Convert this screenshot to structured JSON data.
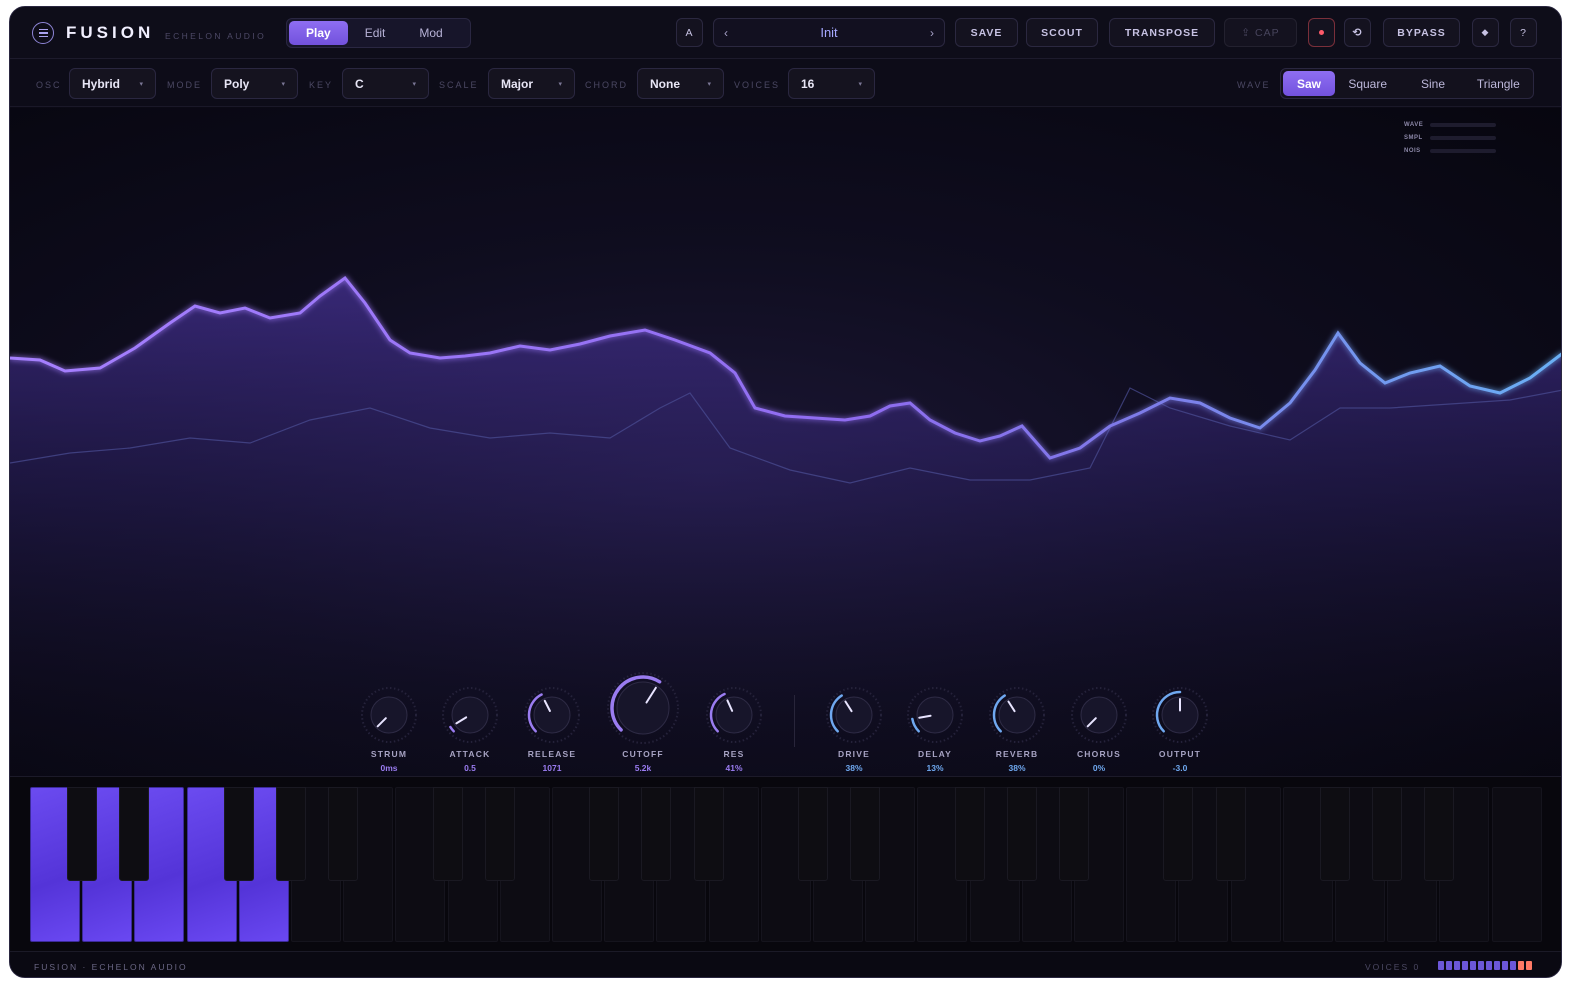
{
  "app": {
    "logo": "FUSION",
    "brand": "ECHELON AUDIO",
    "mode_tabs": [
      "Play",
      "Edit",
      "Mod"
    ],
    "active_mode": "Play"
  },
  "toolbar": {
    "ab_label": "A",
    "prev_arrow": "‹",
    "next_arrow": "›",
    "preset_name": "Init",
    "save_label": "SAVE",
    "scout_label": "SCOUT",
    "transpose_label": "TRANSPOSE",
    "cap_label": "⇪ CAP",
    "undo_glyph": "⟲",
    "bypass_label": "BYPASS",
    "diamond_glyph": "◆",
    "help_label": "?"
  },
  "controls": {
    "osc": {
      "label": "OSC",
      "value": "Hybrid"
    },
    "mode": {
      "label": "MODE",
      "value": "Poly"
    },
    "key": {
      "label": "KEY",
      "value": "C"
    },
    "scale": {
      "label": "SCALE",
      "value": "Major"
    },
    "chord": {
      "label": "CHORD",
      "value": "None"
    },
    "voices": {
      "label": "VOICES",
      "value": "16"
    },
    "caret": "▾",
    "wave": {
      "label": "WAVE",
      "options": [
        "Saw",
        "Square",
        "Sine",
        "Triangle"
      ],
      "selected": "Saw"
    }
  },
  "meters": [
    "WAVE",
    "SMPL",
    "NOIS"
  ],
  "knobs": [
    {
      "label": "STRUM",
      "value": "0ms",
      "level": 0.0,
      "color": "#9a7cf0"
    },
    {
      "label": "ATTACK",
      "value": "0.5",
      "level": 0.05,
      "color": "#9a7cf0"
    },
    {
      "label": "RELEASE",
      "value": "1071",
      "level": 0.4,
      "color": "#9a7cf0"
    },
    {
      "label": "CUTOFF",
      "value": "5.2k",
      "level": 0.62,
      "color": "#9a7cf0"
    },
    {
      "label": "RES",
      "value": "41%",
      "level": 0.41,
      "color": "#9a7cf0"
    },
    {
      "label": "DRIVE",
      "value": "38%",
      "level": 0.38,
      "color": "#6fa8f0"
    },
    {
      "label": "DELAY",
      "value": "13%",
      "level": 0.13,
      "color": "#6fa8f0"
    },
    {
      "label": "REVERB",
      "value": "38%",
      "level": 0.38,
      "color": "#6fa8f0"
    },
    {
      "label": "CHORUS",
      "value": "0%",
      "level": 0.0,
      "color": "#6fa8f0"
    },
    {
      "label": "OUTPUT",
      "value": "-3.0",
      "level": 0.5,
      "color": "#6fa8f0"
    }
  ],
  "keyboard": {
    "white_keys": 29,
    "active_white_keys": [
      0,
      1,
      2,
      3,
      4
    ]
  },
  "footer": {
    "left": "FUSION · ECHELON AUDIO",
    "voices_label": "VOICES 0"
  },
  "colors": {
    "accent": "#7b5ce8",
    "accent_blue": "#6fa8f0",
    "background": "#0b0a15",
    "record": "#ff5a6a"
  }
}
